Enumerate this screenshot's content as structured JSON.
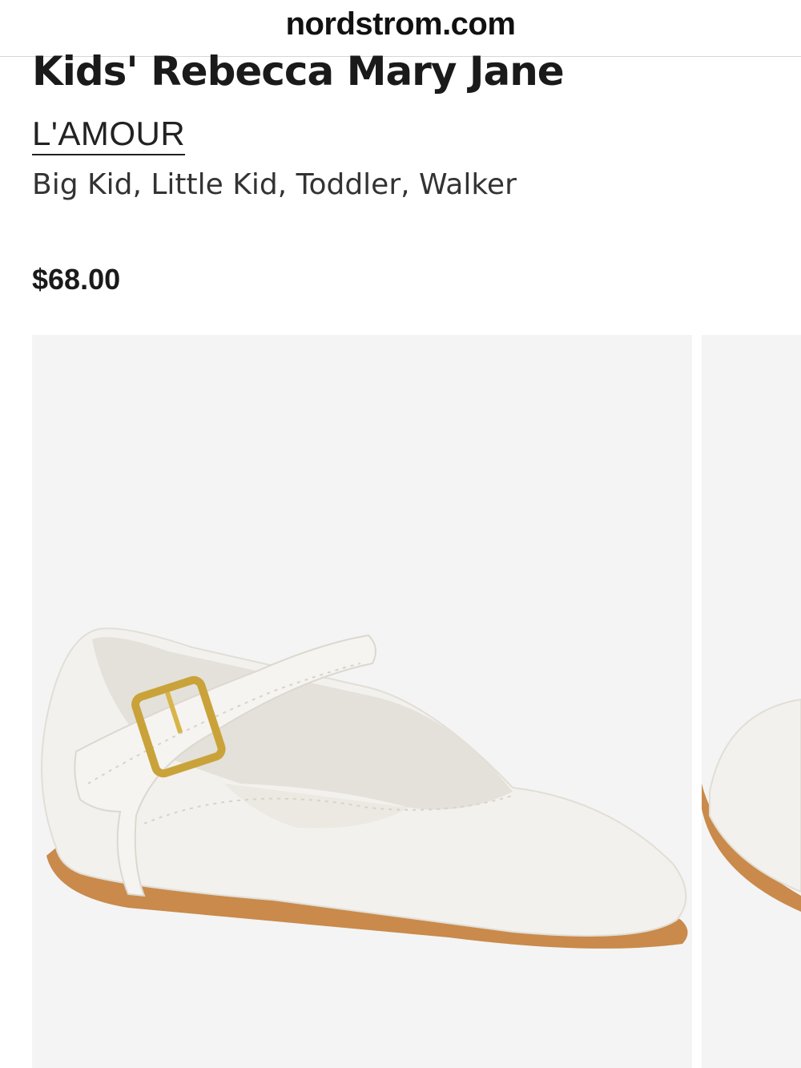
{
  "browser": {
    "url": "nordstrom.com"
  },
  "product": {
    "title": "Kids' Rebecca Mary Jane",
    "brand": "L'AMOUR",
    "sizes": "Big Kid, Little Kid, Toddler, Walker",
    "price": "$68.00"
  },
  "gallery": {
    "images": [
      {
        "name": "white-mary-jane-shoe-photo"
      },
      {
        "name": "next-shoe-photo-partial"
      }
    ]
  },
  "colors": {
    "background": "#ffffff",
    "photo_background": "#f4f4f4",
    "text": "#1a1a1a",
    "shoe_white": "#f2f0ec",
    "sole_tan": "#c98a4b",
    "buckle_gold": "#c9a33a"
  }
}
